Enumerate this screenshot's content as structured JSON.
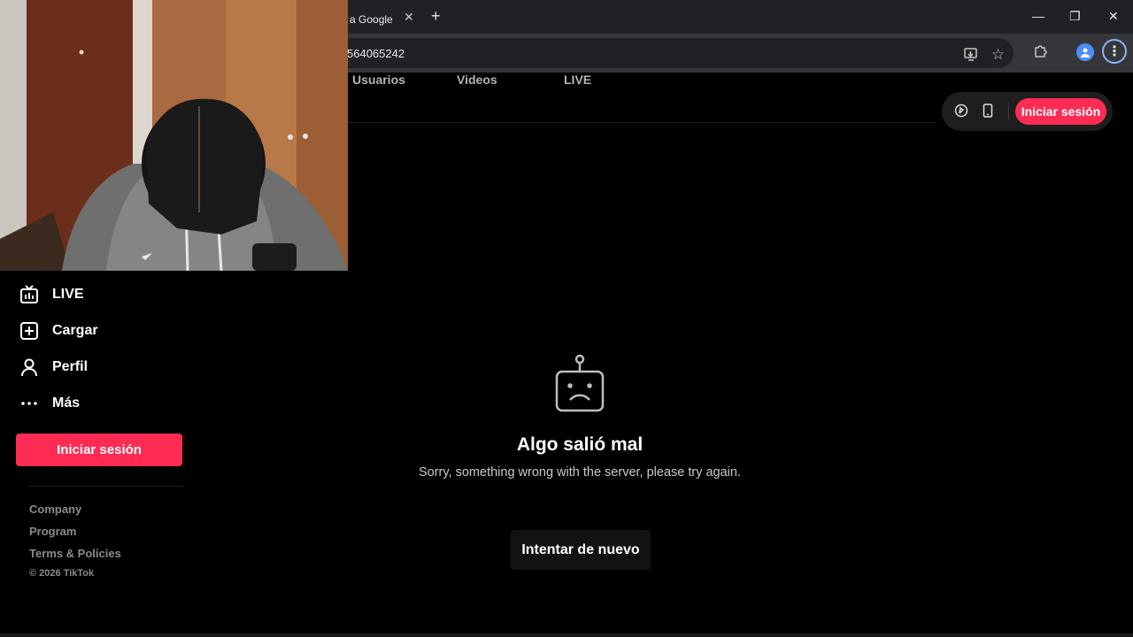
{
  "browser": {
    "tab_title": "a Google",
    "tab_close": "✕",
    "new_tab": "+",
    "url": "564065242",
    "window_controls": {
      "minimize": "—",
      "restore": "❐",
      "close": "✕"
    },
    "toolbar_icons": [
      "install-icon",
      "bookmark-star-icon",
      "extensions-icon",
      "profile-icon",
      "menu-icon"
    ],
    "menu_glyph": "⋮"
  },
  "header": {
    "tabs": [
      "Usuarios",
      "Videos",
      "LIVE"
    ],
    "icons": [
      "coin-icon",
      "mobile-icon"
    ],
    "login_label": "Iniciar sesión"
  },
  "sidebar": {
    "items": [
      {
        "label": "LIVE",
        "icon": "live-icon"
      },
      {
        "label": "Cargar",
        "icon": "upload-icon"
      },
      {
        "label": "Perfil",
        "icon": "profile-icon"
      },
      {
        "label": "Más",
        "icon": "more-icon"
      }
    ],
    "login_label": "Iniciar sesión",
    "footer_links": [
      "Company",
      "Program",
      "Terms & Policies"
    ],
    "copyright": "© 2026 TikTok"
  },
  "error": {
    "icon": "sad-robot-icon",
    "title": "Algo salió mal",
    "message": "Sorry, something wrong with the server, please try again.",
    "retry_label": "Intentar de nuevo"
  },
  "colors": {
    "accent": "#fe2c55",
    "background": "#000000",
    "chrome_dark": "#202124",
    "chrome_toolbar": "#35363a"
  },
  "webcam": {
    "description_icon": "webcam-video-overlay"
  }
}
